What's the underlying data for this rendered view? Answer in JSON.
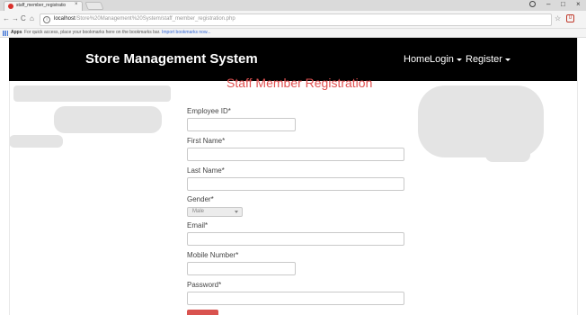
{
  "browser": {
    "tab_title": "staff_member_registratio",
    "tab_close": "×",
    "window_controls": [
      "–",
      "□",
      "×"
    ],
    "nav_buttons": [
      "←",
      "→",
      "C",
      "⌂"
    ],
    "url_host": "localhost",
    "url_path": "/Store%20Management%20System/staff_member_registration.php",
    "bookmark_apps": "Apps",
    "bookmark_hint": "For quick access, place your bookmarks here on the bookmarks bar.",
    "bookmark_import": "Import bookmarks now...",
    "star": "☆",
    "ext": "U",
    "info": "i"
  },
  "navbar": {
    "brand": "Store Management System",
    "home": "Home",
    "login": "Login",
    "register": "Register"
  },
  "form": {
    "heading": "Staff Member Registration",
    "employee_id_label": "Employee ID*",
    "first_name_label": "First Name*",
    "last_name_label": "Last Name*",
    "gender_label": "Gender*",
    "gender_value": "Male",
    "email_label": "Email*",
    "mobile_label": "Mobile Number*",
    "password_label": "Password*"
  },
  "colors": {
    "heading": "#e05050",
    "navbar_bg": "#000000",
    "submit_bg": "#d9534f"
  }
}
